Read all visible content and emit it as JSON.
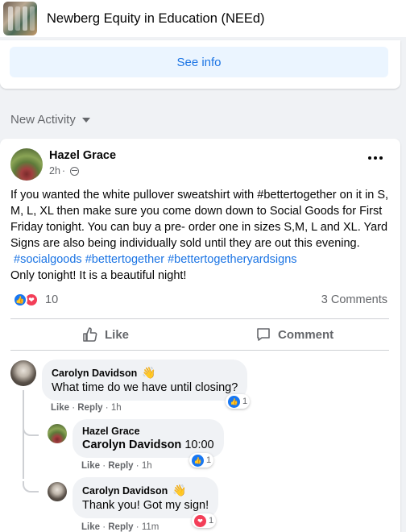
{
  "header": {
    "group_name": "Newberg Equity in Education (NEEd)"
  },
  "info_card": {
    "see_info_label": "See info"
  },
  "feed": {
    "section_label": "New Activity"
  },
  "post": {
    "author": "Hazel Grace",
    "time": "2h",
    "audience_icon": "friends-icon",
    "text_plain": "If you wanted the white pullover sweatshirt with #bettertogether on it in S, M, L, XL then make sure you come down down to Social Goods for First Friday tonight. You can buy a pre- order one in sizes S,M, L and XL. Yard Signs are also being individually sold until they are out this evening.",
    "hashtags": [
      "#socialgoods",
      "#bettertogether",
      "#bettertogetheryardsigns"
    ],
    "text_second": "Only tonight! It is a beautiful night!",
    "reaction_count": "10",
    "comments_count": "3 Comments",
    "like_label": "Like",
    "comment_label": "Comment",
    "colors": {
      "like_blue": "#1877f2",
      "love_red": "#f33e58",
      "link_blue": "#1b74e4"
    }
  },
  "comments": [
    {
      "author": "Carolyn Davidson",
      "badge_icon": "waving-hand-icon",
      "text": "What time do we have until closing?",
      "like_label": "Like",
      "reply_label": "Reply",
      "time": "1h",
      "reaction_count": "1",
      "reaction_type": "like"
    },
    {
      "author": "Hazel Grace",
      "mention": "Carolyn Davidson",
      "text": "10:00",
      "like_label": "Like",
      "reply_label": "Reply",
      "time": "1h",
      "reaction_count": "1",
      "reaction_type": "like"
    },
    {
      "author": "Carolyn Davidson",
      "badge_icon": "waving-hand-icon",
      "text": "Thank you! Got my sign!",
      "like_label": "Like",
      "reply_label": "Reply",
      "time": "11m",
      "reaction_count": "1",
      "reaction_type": "love"
    }
  ]
}
